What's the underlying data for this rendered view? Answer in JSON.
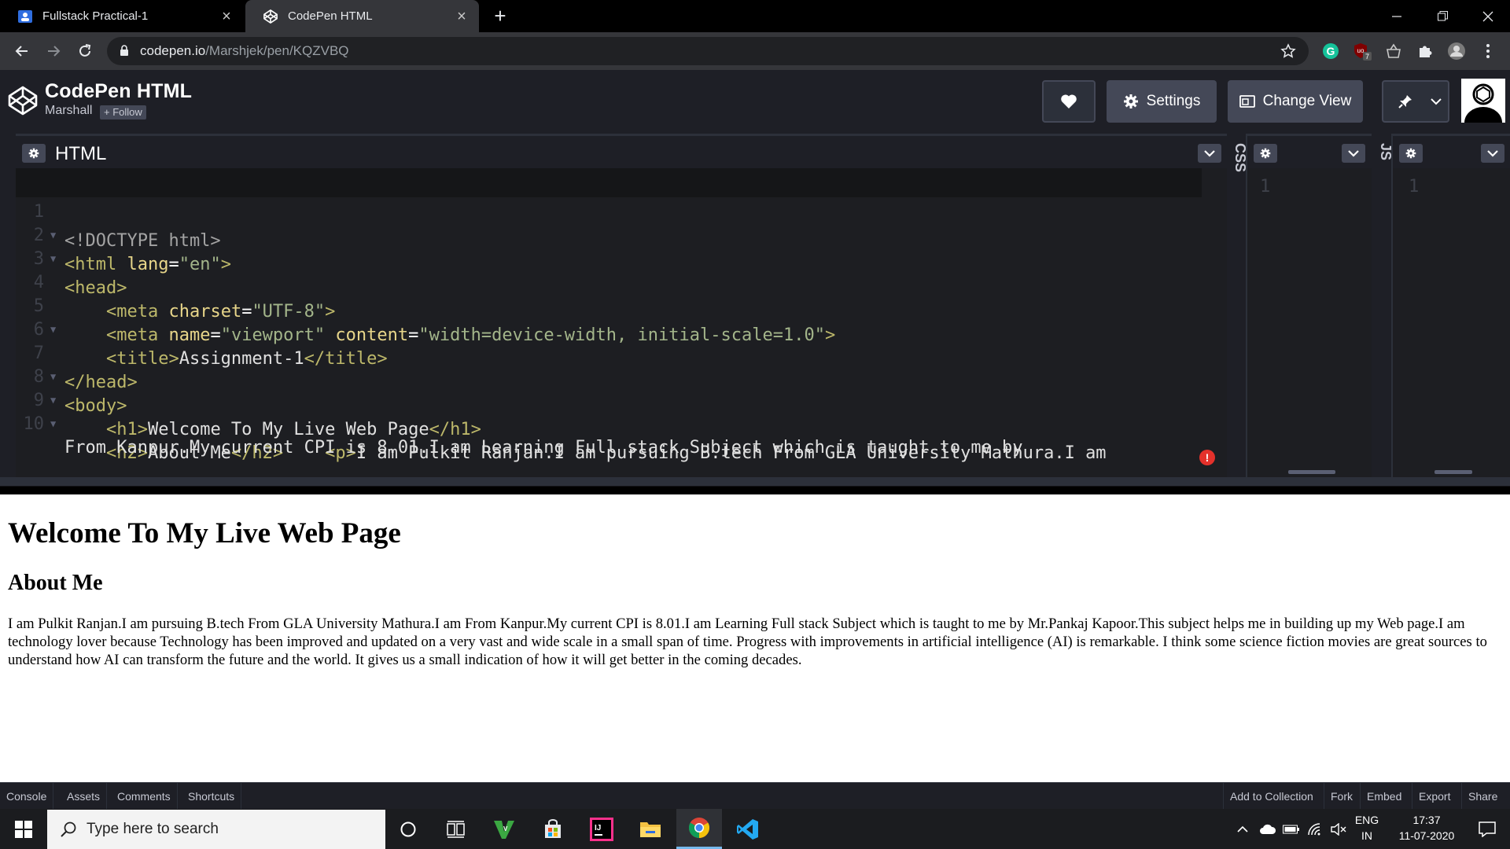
{
  "browser": {
    "tabs": [
      {
        "title": "Fullstack Practical-1",
        "active": false
      },
      {
        "title": "CodePen HTML",
        "active": true
      }
    ],
    "url_host": "codepen.io",
    "url_path": "/Marshjek/pen/KQZVBQ",
    "extension_badge": "7"
  },
  "codepen": {
    "title": "CodePen HTML",
    "author": "Marshall",
    "follow_label": "+ Follow",
    "settings_label": "Settings",
    "change_view_label": "Change View"
  },
  "editors": {
    "html_label": "HTML",
    "css_label": "CSS",
    "js_label": "JS",
    "code_lines": [
      {
        "n": "1"
      },
      {
        "n": "2"
      },
      {
        "n": "3"
      },
      {
        "n": "4"
      },
      {
        "n": "5"
      },
      {
        "n": "6"
      },
      {
        "n": "7"
      },
      {
        "n": "8"
      },
      {
        "n": "9"
      },
      {
        "n": "10"
      }
    ],
    "css_line": "1",
    "js_line": "1"
  },
  "preview": {
    "heading": "Welcome To My Live Web Page",
    "subheading": "About Me",
    "paragraph": "I am Pulkit Ranjan.I am pursuing B.tech From GLA University Mathura.I am From Kanpur.My current CPI is 8.01.I am Learning Full stack Subject which is taught to me by Mr.Pankaj Kapoor.This subject helps me in building up my Web page.I am technology lover because Technology has been improved and updated on a very vast and wide scale in a small span of time. Progress with improvements in artificial intelligence (AI) is remarkable. I think some science fiction movies are great sources to understand how AI can transform the future and the world. It gives us a small indication of how it will get better in the coming decades."
  },
  "footer": {
    "left": [
      "Console",
      "Assets",
      "Comments",
      "Shortcuts"
    ],
    "right": [
      "Add to Collection",
      "Fork",
      "Embed",
      "Export",
      "Share"
    ]
  },
  "taskbar": {
    "search_placeholder": "Type here to search",
    "lang_top": "ENG",
    "lang_bottom": "IN",
    "time": "17:37",
    "date": "11-07-2020"
  },
  "colors": {
    "codepen_bg": "#1e1f26",
    "editor_bg": "#1d1e22",
    "tag": "#bdb86a",
    "string": "#a3b58a",
    "error": "#e4312b"
  }
}
